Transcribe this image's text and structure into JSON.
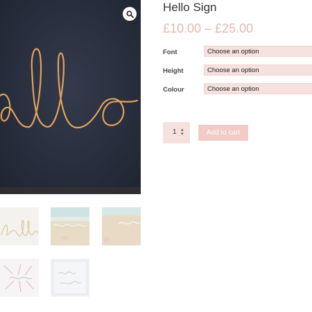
{
  "product": {
    "title": "Hello Sign",
    "price": "£10.00 – £25.00"
  },
  "gallery": {
    "zoom_icon": "magnifier-icon",
    "main_image_text": "hello",
    "thumbnail_count": 5
  },
  "options": [
    {
      "label": "Font",
      "placeholder": "Choose an option"
    },
    {
      "label": "Height",
      "placeholder": "Choose an option"
    },
    {
      "label": "Colour",
      "placeholder": "Choose an option"
    }
  ],
  "cart": {
    "quantity": "1",
    "add_label": "Add to cart"
  },
  "colors": {
    "accent": "#e6b8b0",
    "button": "#f2cbc6",
    "field": "#f5e1dd",
    "wire": "#e2a35c"
  }
}
